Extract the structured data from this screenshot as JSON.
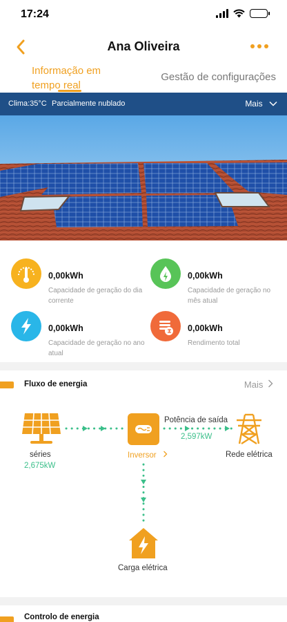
{
  "status_bar": {
    "time": "17:24"
  },
  "nav": {
    "title": "Ana Oliveira",
    "back_icon": "chevron-left-icon",
    "more_icon": "ellipsis-icon"
  },
  "tabs": {
    "active_line1": "Informação em",
    "active_line2": "tempo real",
    "other": "Gestão de configurações"
  },
  "weather": {
    "clima": "Clima:35°C",
    "condition": "Parcialmente nublado",
    "more": "Mais"
  },
  "stats": [
    {
      "value": "0,00kWh",
      "label": "Capacidade de geração do dia corrente",
      "icon": "thermometer-icon",
      "color": "#f7b21f"
    },
    {
      "value": "0,00kWh",
      "label": "Capacidade de geração no mês atual",
      "icon": "water-drop-icon",
      "color": "#58c458"
    },
    {
      "value": "0,00kWh",
      "label": "Capacidade de geração no ano atual",
      "icon": "lightning-icon",
      "color": "#29b6e8"
    },
    {
      "value": "0,00kWh",
      "label": "Rendimento total",
      "icon": "coins-icon",
      "color": "#f06a3a"
    }
  ],
  "energy_flow": {
    "title": "Fluxo de energia",
    "more": "Mais",
    "panels_label": "séries",
    "panels_power": "2,675kW",
    "inverter_label": "Inversor",
    "output_label": "Potência de saída",
    "output_power": "2,597kW",
    "grid_label": "Rede elétrica",
    "load_label": "Carga elétrica"
  },
  "energy_control": {
    "title": "Controlo de energia"
  },
  "colors": {
    "accent": "#f0a020",
    "weather_bar": "#1f4f87",
    "flow_green": "#3bbf8a"
  }
}
